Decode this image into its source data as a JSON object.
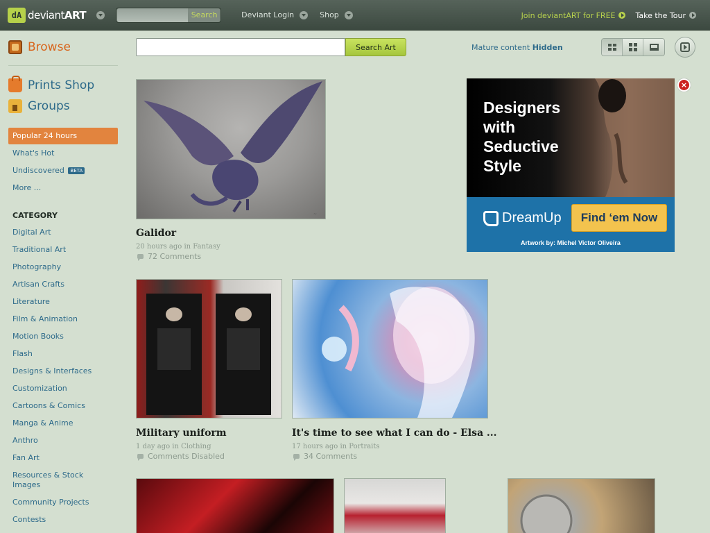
{
  "topbar": {
    "logo_text_light": "deviant",
    "logo_text_bold": "ART",
    "logo_badge": "dA",
    "search_label": "Search",
    "login_label": "Deviant Login",
    "shop_label": "Shop",
    "join_label": "Join deviantART for FREE",
    "tour_label": "Take the Tour"
  },
  "sidebar": {
    "browse_label": "Browse",
    "prints_label": "Prints Shop",
    "groups_label": "Groups",
    "filters": [
      {
        "label": "Popular 24 hours",
        "active": true
      },
      {
        "label": "What's Hot"
      },
      {
        "label": "Undiscovered",
        "badge": "BETA"
      },
      {
        "label": "More ..."
      }
    ],
    "category_heading": "CATEGORY",
    "categories": [
      "Digital Art",
      "Traditional Art",
      "Photography",
      "Artisan Crafts",
      "Literature",
      "Film & Animation",
      "Motion Books",
      "Flash",
      "Designs & Interfaces",
      "Customization",
      "Cartoons & Comics",
      "Manga & Anime",
      "Anthro",
      "Fan Art",
      "Resources & Stock Images",
      "Community Projects",
      "Contests"
    ]
  },
  "search": {
    "value": "",
    "button_label": "Search Art"
  },
  "mature": {
    "label": "Mature content",
    "value": "Hidden"
  },
  "artworks": [
    {
      "title": "Galidor",
      "time": "20 hours ago in",
      "category": "Fantasy",
      "comments": "72 Comments"
    },
    {
      "title": "Military uniform",
      "time": "1 day ago in",
      "category": "Clothing",
      "comments": "Comments Disabled"
    },
    {
      "title": "It's time to see what I can do - Elsa ...",
      "time": "17 hours ago in",
      "category": "Portraits",
      "comments": "34 Comments"
    }
  ],
  "ad": {
    "headline": "Designers with Seductive Style",
    "brand": "DreamUp",
    "cta": "Find ‘em Now",
    "credit": "Artwork by: Michel Victor Oliveira",
    "close": "×"
  }
}
